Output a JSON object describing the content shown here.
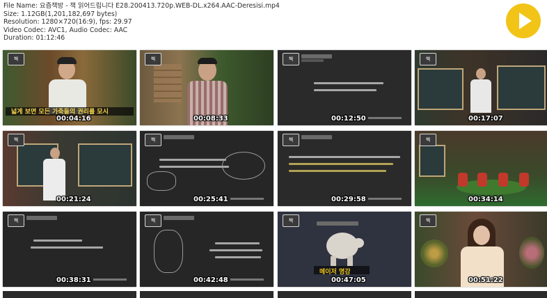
{
  "file_info": {
    "name": "File Name: 요즘책방 - 책 읽어드립니다 E28.200413.720p.WEB-DL.x264.AAC-Deresisi.mp4",
    "size": "Size: 1.12GB(1,201,182,697 bytes)",
    "resolution": "Resolution: 1280×720(16:9), fps: 29.97",
    "codec": "Video Codec: AVC1, Audio Codec: AAC",
    "duration": "Duration: 01:12:46"
  },
  "play_icon": "play-icon",
  "colors": {
    "accent": "#f2c417",
    "timestamp": "#ffffff",
    "frame_bg": "#242424"
  },
  "thumbnails": [
    {
      "timestamp": "00:04:16",
      "caption": "넓게 보면  모든 가축들의 권리를 모시"
    },
    {
      "timestamp": "00:08:33",
      "caption": ""
    },
    {
      "timestamp": "00:12:50",
      "caption": ""
    },
    {
      "timestamp": "00:17:07",
      "caption": ""
    },
    {
      "timestamp": "00:21:24",
      "caption": ""
    },
    {
      "timestamp": "00:25:41",
      "caption": ""
    },
    {
      "timestamp": "00:29:58",
      "caption": ""
    },
    {
      "timestamp": "00:34:14",
      "caption": ""
    },
    {
      "timestamp": "00:38:31",
      "caption": ""
    },
    {
      "timestamp": "00:42:48",
      "caption": ""
    },
    {
      "timestamp": "00:47:05",
      "caption": "메이저 명강"
    },
    {
      "timestamp": "00:51:22",
      "caption": ""
    }
  ]
}
